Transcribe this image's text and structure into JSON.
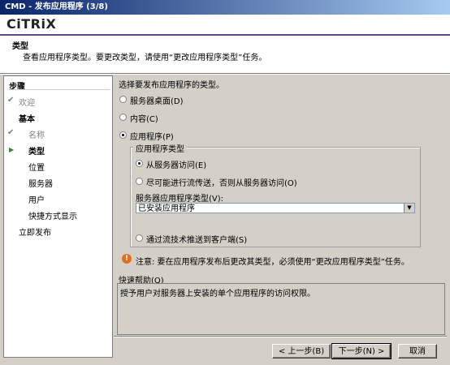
{
  "window": {
    "title": "CMD - 发布应用程序 (3/8)"
  },
  "header": {
    "logo_text": "CiTRiX",
    "title": "类型",
    "description": "查看应用程序类型。要更改类型，请使用“更改应用程序类型”任务。"
  },
  "nav": {
    "heading": "步骤",
    "items": [
      {
        "label": "欢迎",
        "state": "done"
      },
      {
        "label": "基本",
        "state": "section"
      },
      {
        "label": "名称",
        "state": "done"
      },
      {
        "label": "类型",
        "state": "current"
      },
      {
        "label": "位置",
        "state": "pending"
      },
      {
        "label": "服务器",
        "state": "pending"
      },
      {
        "label": "用户",
        "state": "pending"
      },
      {
        "label": "快捷方式显示",
        "state": "pending"
      },
      {
        "label": "立即发布",
        "state": "section-pending"
      }
    ]
  },
  "main": {
    "prompt": "选择要发布应用程序的类型。",
    "options": {
      "server_desktop": "服务器桌面(D)",
      "content": "内容(C)",
      "application": "应用程序(P)"
    },
    "selected_option": "application",
    "app_type_group": {
      "title": "应用程序类型",
      "access_from_server": "从服务器访问(E)",
      "stream_if_possible": "尽可能进行流传送，否则从服务器访问(O)",
      "server_app_type_label": "服务器应用程序类型(V):",
      "server_app_type_value": "已安装应用程序",
      "stream_to_client": "通过流技术推送到客户端(S)",
      "selected": "access_from_server"
    },
    "note": "注意: 要在应用程序发布后更改其类型，必须使用“更改应用程序类型”任务。",
    "quick_help": {
      "title": "快速帮助(Q)",
      "text": "授予用户对服务器上安装的单个应用程序的访问权限。"
    }
  },
  "footer": {
    "back_label": "< 上一步(B)",
    "next_label": "下一步(N) >",
    "cancel_label": "取消"
  },
  "colors": {
    "title_bar": "#0a246a",
    "accent_line": "#5a4a8c",
    "face": "#d4d0c8",
    "warning": "#e07020",
    "current_arrow": "#2e8b2e"
  }
}
